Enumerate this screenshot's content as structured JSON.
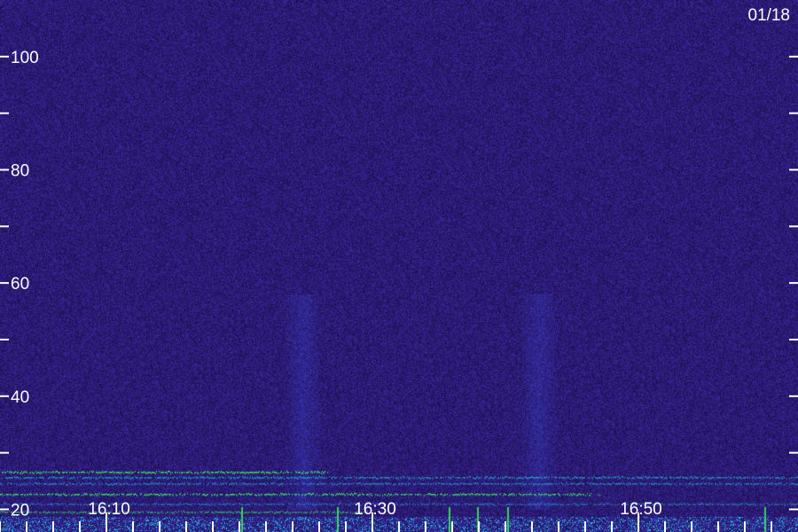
{
  "chart_data": {
    "type": "heatmap",
    "date_label": "01/18",
    "colors": {
      "background": "#2a1a63",
      "noise_dark": "#1c0c4a",
      "noise_light": "#3a2aa0",
      "band": "#3c4be0",
      "low_band_cyan": "#1fc8e8",
      "low_band_green": "#3cff5a",
      "axis": "#ffffff"
    },
    "y_axis": {
      "range": [
        16,
        110
      ],
      "labeled_ticks": [
        {
          "value": 20,
          "label": "20"
        },
        {
          "value": 40,
          "label": "40"
        },
        {
          "value": 60,
          "label": "60"
        },
        {
          "value": 80,
          "label": "80"
        },
        {
          "value": 100,
          "label": "100"
        }
      ],
      "minor_ticks": [
        30,
        50,
        70,
        90
      ]
    },
    "x_axis": {
      "range": [
        16.03,
        17.03
      ],
      "labeled_ticks": [
        {
          "value": 16.1667,
          "label": "16:10"
        },
        {
          "value": 16.5,
          "label": "16:30"
        },
        {
          "value": 16.8333,
          "label": "16:50"
        }
      ]
    },
    "events": [
      {
        "time": 16.41,
        "f_low": 20,
        "f_high": 58
      },
      {
        "time": 16.705,
        "f_low": 20,
        "f_high": 58
      }
    ]
  }
}
